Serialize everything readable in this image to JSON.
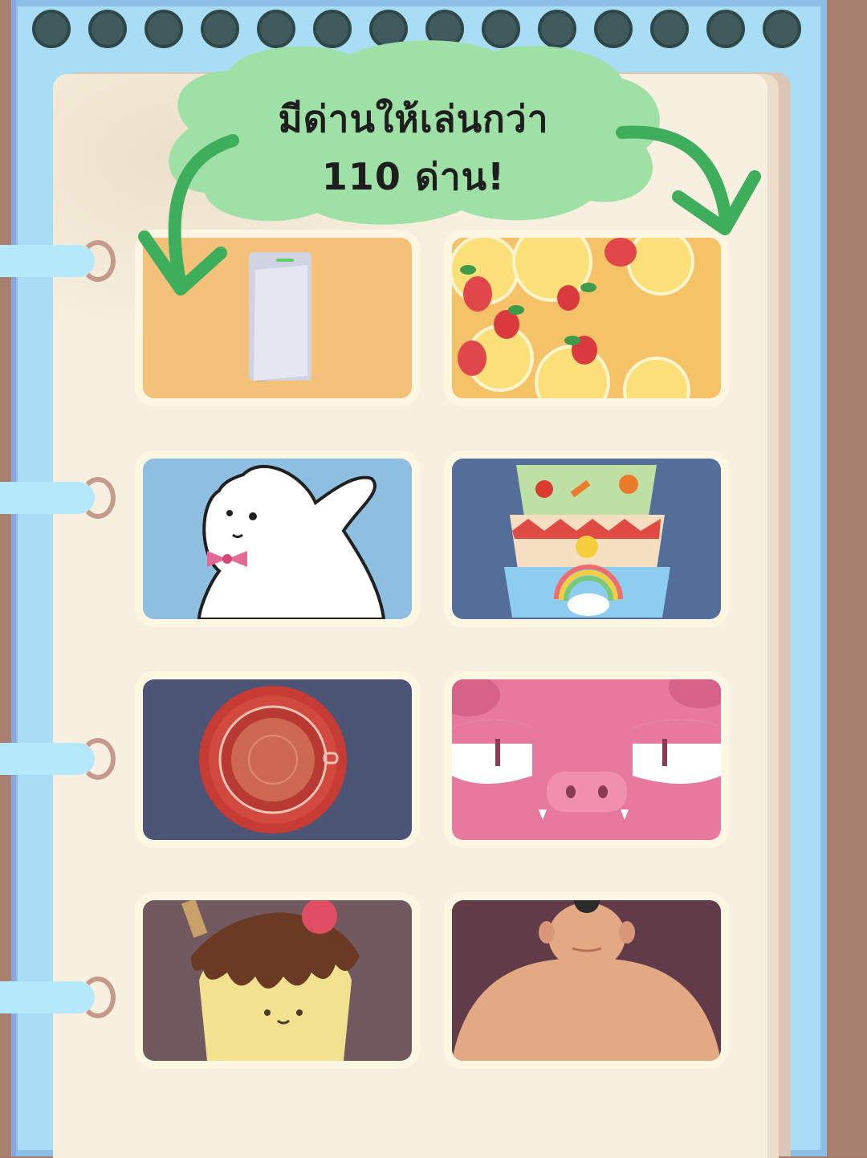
{
  "banner": {
    "line1": "มีด่านให้เล่นกว่า",
    "line2": "110 ด่าน!"
  },
  "colors": {
    "cover": "#a9dcf5",
    "page": "#f7f0e0",
    "banner": "#9fe0a6",
    "arrow": "#3fae5c"
  },
  "levels": [
    {
      "name": "light switch",
      "icon": "light-switch-icon"
    },
    {
      "name": "fruit tart",
      "icon": "fruit-tart-icon"
    },
    {
      "name": "bunny",
      "icon": "bunny-icon"
    },
    {
      "name": "stacked bowls",
      "icon": "stacked-bowls-icon"
    },
    {
      "name": "tea cup",
      "icon": "tea-cup-icon"
    },
    {
      "name": "pig face",
      "icon": "pig-face-icon"
    },
    {
      "name": "pudding",
      "icon": "pudding-icon"
    },
    {
      "name": "sumo",
      "icon": "sumo-icon"
    }
  ]
}
